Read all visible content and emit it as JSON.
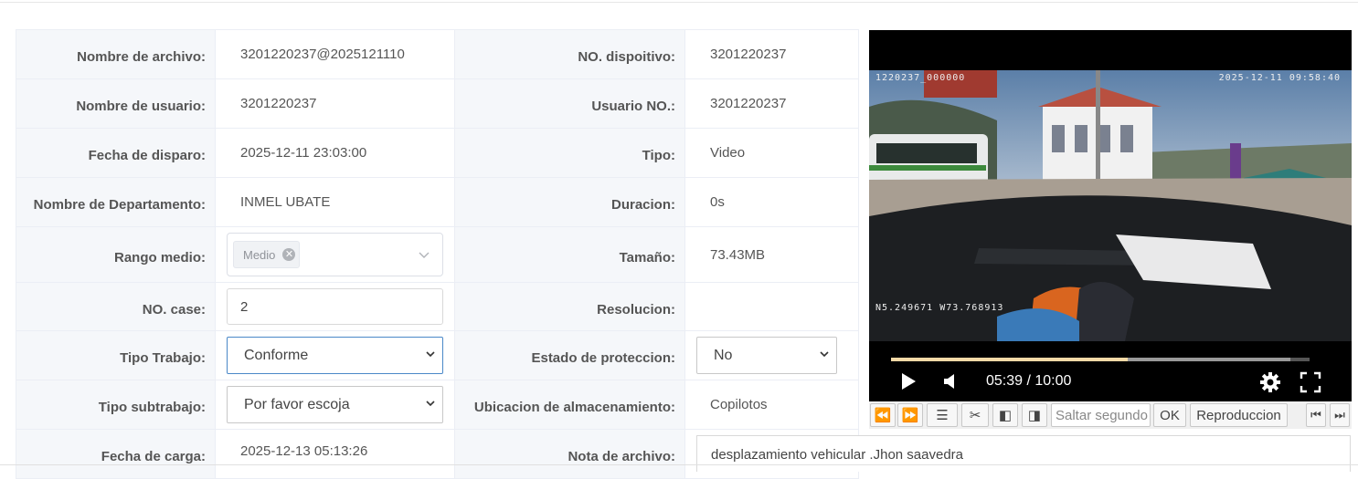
{
  "fields": {
    "file_name": {
      "label": "Nombre de archivo:",
      "value": "3201220237@2025121110"
    },
    "device_no": {
      "label": "NO. dispoitivo:",
      "value": "3201220237"
    },
    "user_name": {
      "label": "Nombre de usuario:",
      "value": "3201220237"
    },
    "user_no": {
      "label": "Usuario NO.:",
      "value": "3201220237"
    },
    "trigger_date": {
      "label": "Fecha de disparo:",
      "value": "2025-12-11 23:03:00"
    },
    "type": {
      "label": "Tipo:",
      "value": "Video"
    },
    "department": {
      "label": "Nombre de Departamento:",
      "value": "INMEL UBATE"
    },
    "duration": {
      "label": "Duracion:",
      "value": "0s"
    },
    "range": {
      "label": "Rango medio:",
      "tag": "Medio"
    },
    "size": {
      "label": "Tamaño:",
      "value": "73.43MB"
    },
    "case_no": {
      "label": "NO. case:",
      "value": "2"
    },
    "resolution": {
      "label": "Resolucion:",
      "value": ""
    },
    "work_type": {
      "label": "Tipo Trabajo:",
      "selected": "Conforme"
    },
    "protection": {
      "label": "Estado de proteccion:",
      "selected": "No"
    },
    "sub_type": {
      "label": "Tipo subtrabajo:",
      "selected": "Por favor escoja"
    },
    "storage": {
      "label": "Ubicacion de almacenamiento:",
      "value": "Copilotos"
    },
    "upload_date": {
      "label": "Fecha de carga:",
      "value": "2025-12-13 05:13:26"
    },
    "file_note": {
      "label": "Nota de archivo:",
      "value": "desplazamiento vehicular .Jhon saavedra"
    }
  },
  "video": {
    "osd_id": "1220237_000000",
    "osd_datetime": "2025-12-11  09:58:40",
    "osd_gps": "N5.249671  W73.768913",
    "time_display": "05:39 / 10:00",
    "progress": 0.565,
    "buffered": 0.955
  },
  "toolbar": {
    "seek_placeholder": "Saltar segundo",
    "ok_label": "OK",
    "playback_label": "Reproduccion"
  }
}
